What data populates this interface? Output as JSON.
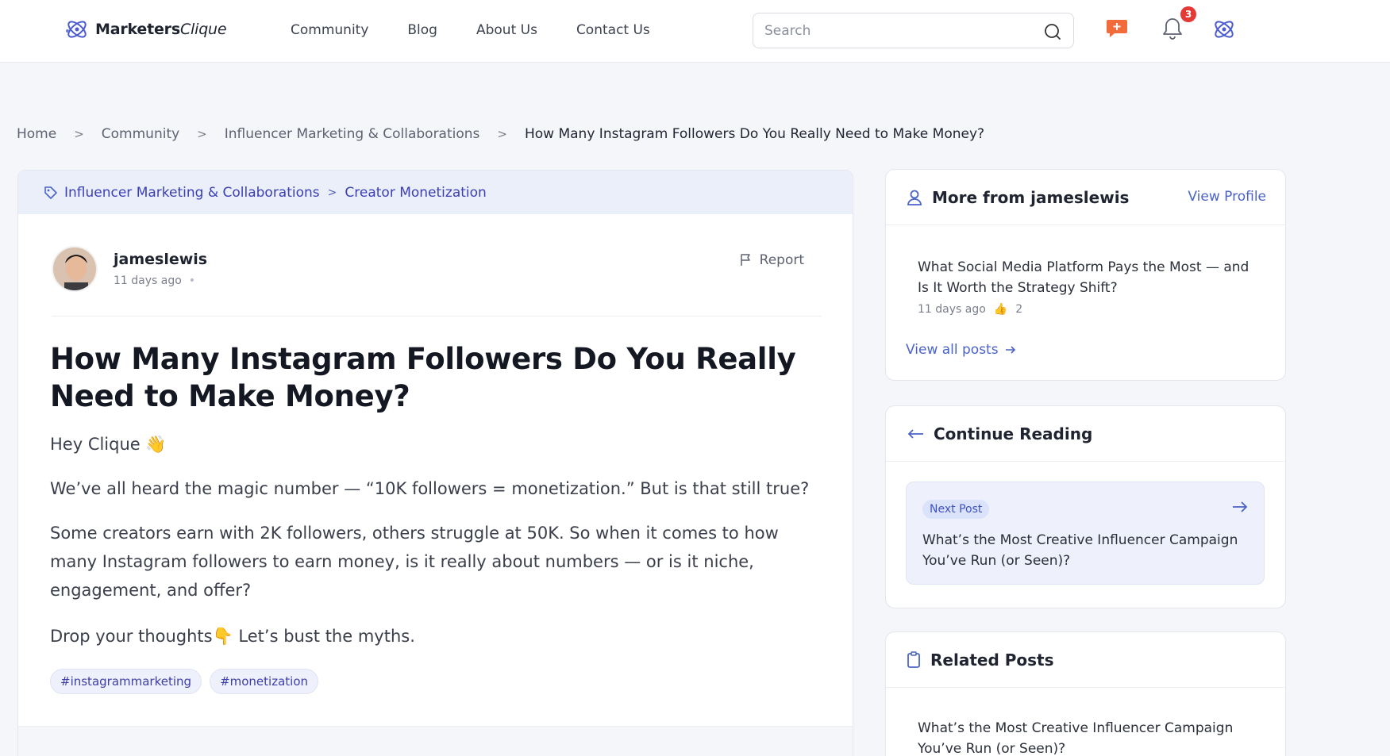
{
  "header": {
    "logo_bold": "Marketers",
    "logo_italic": "Clique",
    "nav": [
      "Community",
      "Blog",
      "About Us",
      "Contact Us"
    ],
    "search_placeholder": "Search",
    "notification_count": "3",
    "icons": [
      "search-icon",
      "new-post-icon",
      "bell-icon",
      "profile-logo-icon"
    ],
    "accent_color": "#4b63c9",
    "badge_color": "#e53935",
    "new_post_icon_color": "#f26b3a"
  },
  "breadcrumb": {
    "items": [
      "Home",
      "Community",
      "Influencer Marketing & Collaborations"
    ],
    "current": "How Many Instagram Followers Do You Really Need to Make Money?"
  },
  "post": {
    "category": "Influencer Marketing & Collaborations",
    "subcategory": "Creator Monetization",
    "author": "jameslewis",
    "time": "11 days ago",
    "report_label": "Report",
    "title": "How Many Instagram Followers Do You Really Need to Make Money?",
    "paragraphs": [
      "Hey Clique 👋",
      "We’ve all heard the magic number — “10K followers = monetization.” But is that still true?",
      "Some creators earn with 2K followers, others struggle at 50K. So when it comes to how many Instagram followers to earn money, is it really about numbers — or is it niche, engagement, and offer?",
      "Drop your thoughts👇 Let’s bust the myths."
    ],
    "tags": [
      "#instagrammarketing",
      "#monetization"
    ]
  },
  "sidebar": {
    "more_from": {
      "title": "More from jameslewis",
      "view_profile": "View Profile",
      "post_title": "What Social Media Platform Pays the Most — and Is It Worth the Strategy Shift?",
      "post_time": "11 days ago",
      "post_likes": "2",
      "view_all": "View all posts"
    },
    "continue_reading": {
      "title": "Continue Reading",
      "pill": "Next Post",
      "next_title": "What’s the Most Creative Influencer Campaign You’ve Run (or Seen)?"
    },
    "related": {
      "title": "Related Posts",
      "first_title": "What’s the Most Creative Influencer Campaign You’ve Run (or Seen)?"
    }
  }
}
